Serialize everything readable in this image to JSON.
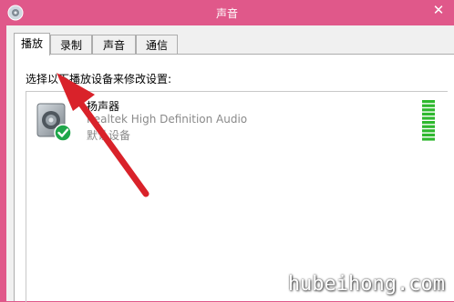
{
  "window": {
    "title": "声音",
    "close_glyph": "✕"
  },
  "tabs": [
    {
      "label": "播放",
      "active": true
    },
    {
      "label": "录制",
      "active": false
    },
    {
      "label": "声音",
      "active": false
    },
    {
      "label": "通信",
      "active": false
    }
  ],
  "panel": {
    "instruction": "选择以下播放设备来修改设置:",
    "devices": [
      {
        "name": "扬声器",
        "description": "Realtek High Definition Audio",
        "status": "默认设备",
        "icon": "speaker-icon",
        "status_icon": "default-check-icon",
        "level_segments": 10
      }
    ]
  },
  "annotation": {
    "arrow_color": "#d9222a"
  },
  "watermark": "hubeihong.com",
  "colors": {
    "titlebar": "#e0588a",
    "meter_green": "#2eb82e"
  }
}
